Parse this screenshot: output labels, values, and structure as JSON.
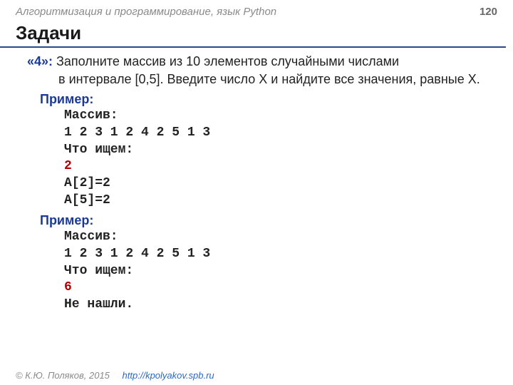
{
  "header": {
    "course": "Алгоритмизация и программирование, язык Python",
    "page": "120"
  },
  "title": "Задачи",
  "task": {
    "label": "«4»:",
    "line1": "Заполните массив из 10 элементов случайными числами",
    "line2": "в интервале [0,5]. Введите число X и найдите все значения, равные X."
  },
  "example1": {
    "label": "Пример:",
    "l1": "Массив:",
    "l2": "1 2 3 1 2 4 2 5 1 3",
    "l3": "Что ищем:",
    "l4": "2",
    "l5": "A[2]=2",
    "l6": "A[5]=2"
  },
  "example2": {
    "label": "Пример:",
    "l1": "Массив:",
    "l2": "1 2 3 1 2 4 2 5 1 3",
    "l3": "Что ищем:",
    "l4": "6",
    "l5": "Не нашли."
  },
  "footer": {
    "copyright": "© К.Ю. Поляков, 2015",
    "url": "http://kpolyakov.spb.ru"
  }
}
